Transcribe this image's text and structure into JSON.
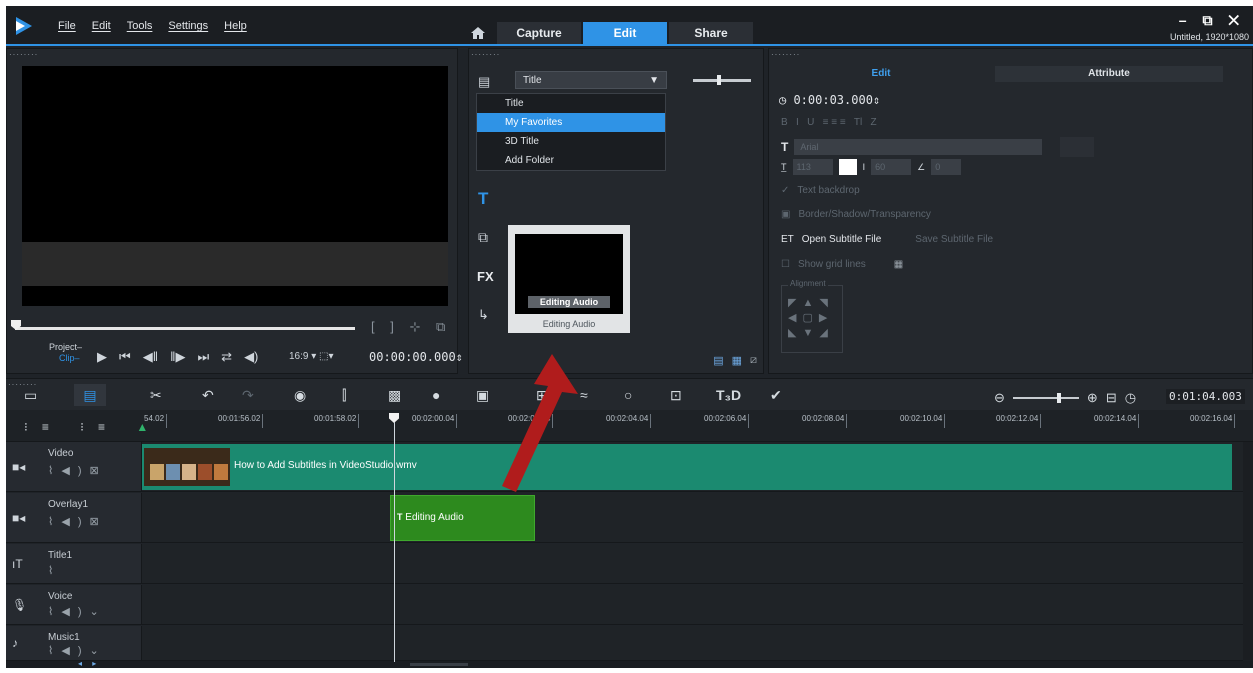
{
  "menu": [
    "File",
    "Edit",
    "Tools",
    "Settings",
    "Help"
  ],
  "tabs": {
    "capture": "Capture",
    "edit": "Edit",
    "share": "Share"
  },
  "window": {
    "controls": "– ⧉ ✕",
    "project_info": "Untitled, 1920*1080"
  },
  "preview": {
    "project_label": "Project–",
    "clip_label": "Clip–",
    "aspect_label": "16:9",
    "timecode": "00:00:00.000"
  },
  "library": {
    "dropdown_selected": "Title",
    "dropdown_items": [
      "Title",
      "My Favorites",
      "3D Title",
      "Add Folder"
    ],
    "dropdown_highlight": "My Favorites",
    "fx_label": "FX",
    "thumb_caption": "Editing Audio",
    "thumb_label": "Editing Audio"
  },
  "options": {
    "tab_edit": "Edit",
    "tab_attribute": "Attribute",
    "duration": "0:00:03.000",
    "font_placeholder": "Arial",
    "size_value": "113",
    "line_spacing": "60",
    "angle_value": "0",
    "text_backdrop": "Text backdrop",
    "border_shadow": "Border/Shadow/Transparency",
    "open_subtitle": "Open Subtitle File",
    "save_subtitle": "Save Subtitle File",
    "show_grid": "Show grid lines",
    "alignment": "Alignment"
  },
  "timeline": {
    "total_time": "0:01:04.003",
    "ruler_ticks": [
      "54.02",
      "00:01:56.02",
      "00:01:58.02",
      "00:02:00.04",
      "00:02:02.04",
      "00:02:04.04",
      "00:02:06.04",
      "00:02:08.04",
      "00:02:10.04",
      "00:02:12.04",
      "00:02:14.04",
      "00:02:16.04"
    ],
    "tracks": [
      {
        "name": "Video"
      },
      {
        "name": "Overlay1"
      },
      {
        "name": "Title1"
      },
      {
        "name": "Voice"
      },
      {
        "name": "Music1"
      }
    ],
    "video_clip": "How to Add Subtitles in VideoStudio.wmv",
    "overlay_clip": "Editing Audio"
  },
  "colors": {
    "accent": "#2f93e6",
    "video_clip": "#1b8a70",
    "title_clip": "#2d8a1e",
    "arrow": "#b01c1c"
  }
}
